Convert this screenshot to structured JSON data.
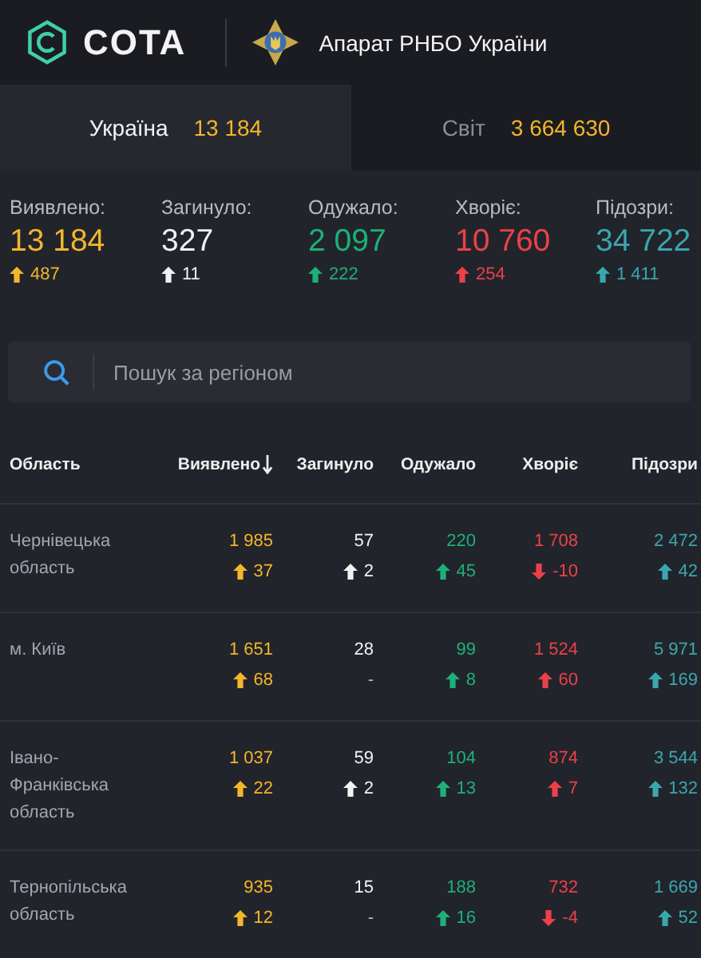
{
  "header": {
    "brand": "COTA",
    "org": "Апарат РНБО України"
  },
  "tabs": [
    {
      "label": "Україна",
      "count": "13 184",
      "selected": true
    },
    {
      "label": "Світ",
      "count": "3 664 630",
      "selected": false
    }
  ],
  "summary": [
    {
      "label": "Виявлено:",
      "value": "13 184",
      "delta": "487",
      "color": "#f4b62a"
    },
    {
      "label": "Загинуло:",
      "value": "327",
      "delta": "11",
      "color": "#f2f2f2"
    },
    {
      "label": "Одужало:",
      "value": "2 097",
      "delta": "222",
      "color": "#1db177"
    },
    {
      "label": "Хворіє:",
      "value": "10 760",
      "delta": "254",
      "color": "#eb4149"
    },
    {
      "label": "Підозри:",
      "value": "34 722",
      "delta": "1 411",
      "color": "#3aa7ae"
    }
  ],
  "search": {
    "placeholder": "Пошук за регіоном"
  },
  "table": {
    "columns": [
      {
        "label": "Область",
        "sorted": false
      },
      {
        "label": "Виявлено",
        "sorted": true
      },
      {
        "label": "Загинуло",
        "sorted": false
      },
      {
        "label": "Одужало",
        "sorted": false
      },
      {
        "label": "Хворіє",
        "sorted": false
      },
      {
        "label": "Підозри",
        "sorted": false
      }
    ],
    "rows": [
      {
        "cells": [
          {
            "kind": "region",
            "value": "Чернівецька область"
          },
          {
            "kind": "up",
            "value": "1 985",
            "delta": "37",
            "color": "#f4b62a"
          },
          {
            "kind": "up",
            "value": "57",
            "delta": "2",
            "color": "#f2f2f2"
          },
          {
            "kind": "up",
            "value": "220",
            "delta": "45",
            "color": "#1db177"
          },
          {
            "kind": "down",
            "value": "1 708",
            "delta": "-10",
            "color": "#eb4149"
          },
          {
            "kind": "up",
            "value": "2 472",
            "delta": "42",
            "color": "#3aa7ae"
          }
        ]
      },
      {
        "cells": [
          {
            "kind": "region",
            "value": "м. Київ"
          },
          {
            "kind": "up",
            "value": "1 651",
            "delta": "68",
            "color": "#f4b62a"
          },
          {
            "kind": "flat",
            "value": "28",
            "delta": "-",
            "color": "#f2f2f2"
          },
          {
            "kind": "up",
            "value": "99",
            "delta": "8",
            "color": "#1db177"
          },
          {
            "kind": "up",
            "value": "1 524",
            "delta": "60",
            "color": "#eb4149"
          },
          {
            "kind": "up",
            "value": "5 971",
            "delta": "169",
            "color": "#3aa7ae"
          }
        ]
      },
      {
        "cells": [
          {
            "kind": "region",
            "value": "Івано-Франківська область"
          },
          {
            "kind": "up",
            "value": "1 037",
            "delta": "22",
            "color": "#f4b62a"
          },
          {
            "kind": "up",
            "value": "59",
            "delta": "2",
            "color": "#f2f2f2"
          },
          {
            "kind": "up",
            "value": "104",
            "delta": "13",
            "color": "#1db177"
          },
          {
            "kind": "up",
            "value": "874",
            "delta": "7",
            "color": "#eb4149"
          },
          {
            "kind": "up",
            "value": "3 544",
            "delta": "132",
            "color": "#3aa7ae"
          }
        ]
      },
      {
        "cells": [
          {
            "kind": "region",
            "value": "Тернопільська область"
          },
          {
            "kind": "up",
            "value": "935",
            "delta": "12",
            "color": "#f4b62a"
          },
          {
            "kind": "flat",
            "value": "15",
            "delta": "-",
            "color": "#f2f2f2"
          },
          {
            "kind": "up",
            "value": "188",
            "delta": "16",
            "color": "#1db177"
          },
          {
            "kind": "down",
            "value": "732",
            "delta": "-4",
            "color": "#eb4149"
          },
          {
            "kind": "up",
            "value": "1 669",
            "delta": "52",
            "color": "#3aa7ae"
          }
        ]
      }
    ]
  }
}
